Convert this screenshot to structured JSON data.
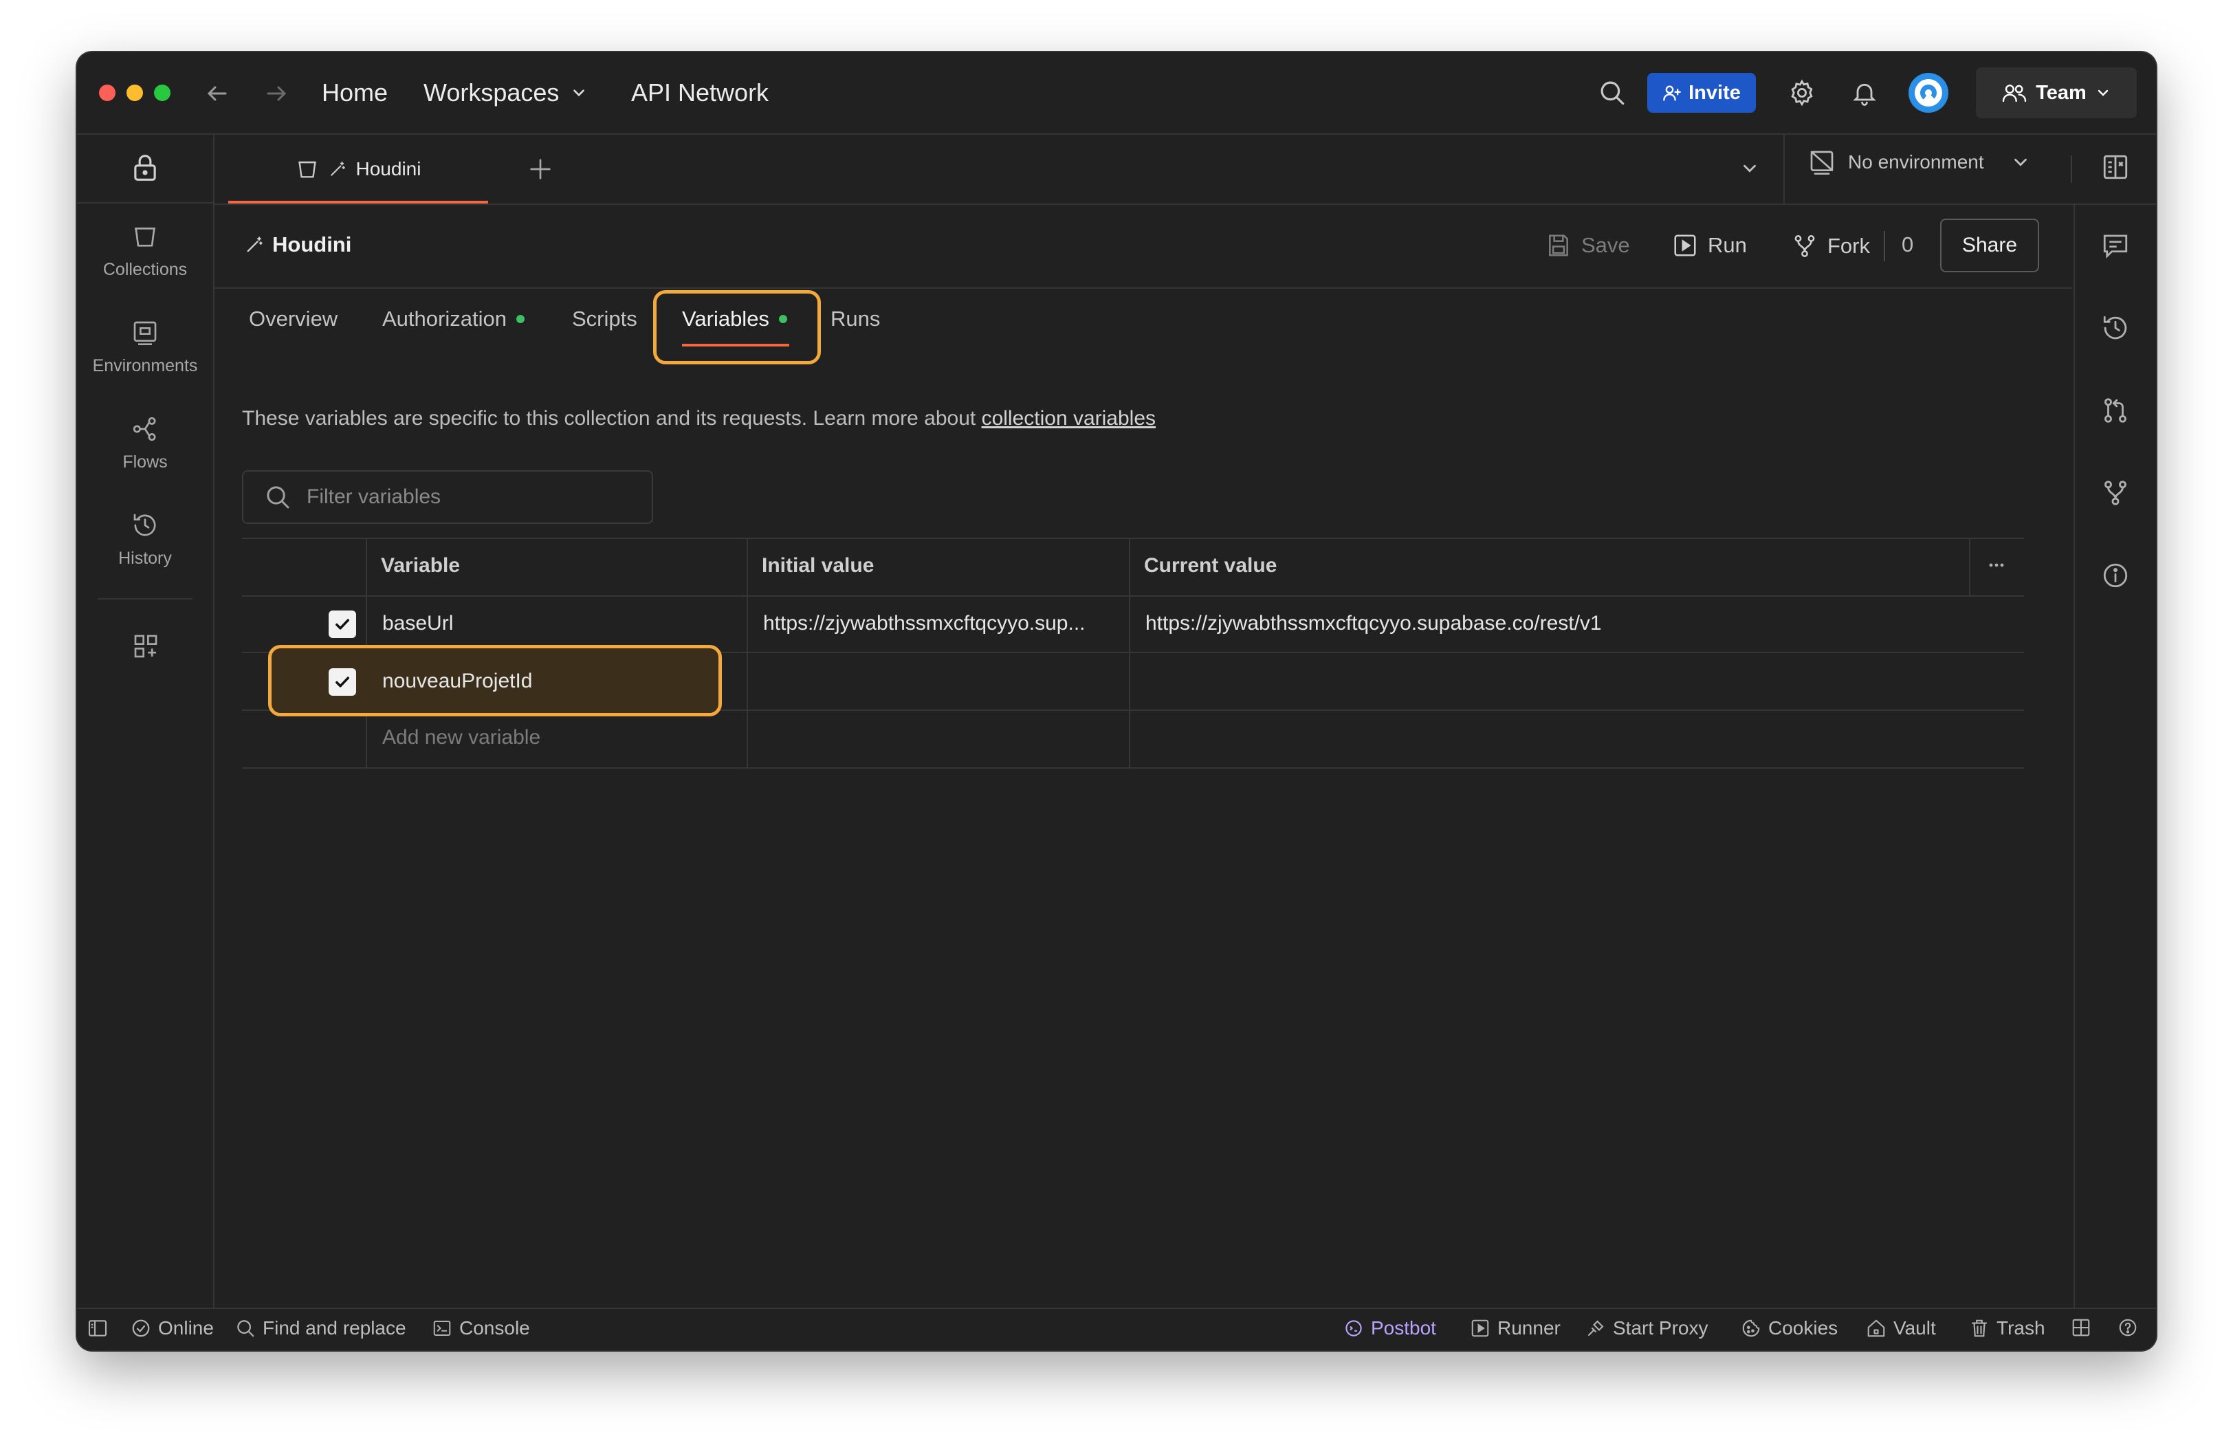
{
  "titlebar": {
    "nav": {
      "home": "Home",
      "workspaces": "Workspaces",
      "api_network": "API Network"
    },
    "invite_label": "Invite",
    "team_label": "Team"
  },
  "sidebar": {
    "items": [
      {
        "label": "Collections"
      },
      {
        "label": "Environments"
      },
      {
        "label": "Flows"
      },
      {
        "label": "History"
      }
    ]
  },
  "tabs": {
    "active_label": "Houdini",
    "environment_label": "No environment"
  },
  "header": {
    "title": "Houdini",
    "save_label": "Save",
    "run_label": "Run",
    "fork_label": "Fork",
    "fork_count": "0",
    "share_label": "Share"
  },
  "subtabs": {
    "overview": "Overview",
    "authorization": "Authorization",
    "scripts": "Scripts",
    "variables": "Variables",
    "runs": "Runs"
  },
  "variables": {
    "description": "These variables are specific to this collection and its requests. Learn more about ",
    "link_text": "collection variables",
    "filter_placeholder": "Filter variables",
    "columns": {
      "variable": "Variable",
      "initial": "Initial value",
      "current": "Current value"
    },
    "rows": [
      {
        "name": "baseUrl",
        "initial": "https://zjywabthssmxcftqcyyo.sup...",
        "current": "https://zjywabthssmxcftqcyyo.supabase.co/rest/v1",
        "checked": true
      },
      {
        "name": "nouveauProjetId",
        "initial": "",
        "current": "",
        "checked": true
      }
    ],
    "add_placeholder": "Add new variable"
  },
  "statusbar": {
    "online": "Online",
    "find_replace": "Find and replace",
    "console": "Console",
    "postbot": "Postbot",
    "runner": "Runner",
    "start_proxy": "Start Proxy",
    "cookies": "Cookies",
    "vault": "Vault",
    "trash": "Trash"
  },
  "colors": {
    "accent_orange": "#ef6a43",
    "highlight": "#f3a93b",
    "invite_blue": "#1e58c8",
    "status_green": "#3fbf63",
    "postbot_purple": "#b9a4ff"
  }
}
